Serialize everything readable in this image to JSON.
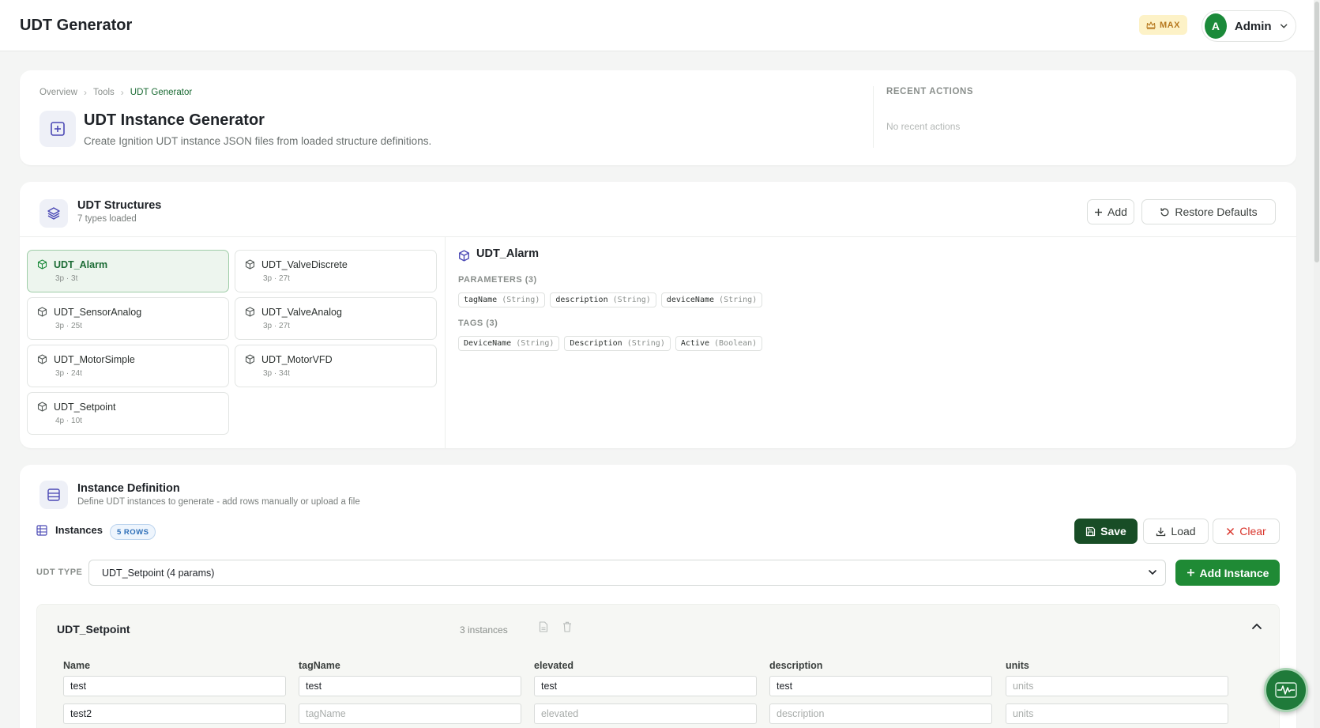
{
  "app": {
    "title": "UDT Generator",
    "plan_badge": "MAX",
    "user_initial": "A",
    "user_name": "Admin"
  },
  "colors": {
    "accent_green": "#1f8a35",
    "dark_green": "#184d26",
    "danger": "#d9342b",
    "badge_blue": "#2e6fb8"
  },
  "header_card": {
    "breadcrumb": [
      "Overview",
      "Tools",
      "UDT Generator"
    ],
    "title": "UDT Instance Generator",
    "subtitle": "Create Ignition UDT instance JSON files from loaded structure definitions.",
    "recent_label": "RECENT ACTIONS",
    "recent_empty": "No recent actions",
    "icon": "plus-square-icon"
  },
  "structures": {
    "title": "UDT Structures",
    "subtitle": "7 types loaded",
    "add_label": "Add",
    "restore_label": "Restore Defaults",
    "items": [
      {
        "name": "UDT_Alarm",
        "meta": "3p · 3t",
        "active": true
      },
      {
        "name": "UDT_ValveDiscrete",
        "meta": "3p · 27t",
        "active": false
      },
      {
        "name": "UDT_SensorAnalog",
        "meta": "3p · 25t",
        "active": false
      },
      {
        "name": "UDT_ValveAnalog",
        "meta": "3p · 27t",
        "active": false
      },
      {
        "name": "UDT_MotorSimple",
        "meta": "3p · 24t",
        "active": false
      },
      {
        "name": "UDT_MotorVFD",
        "meta": "3p · 34t",
        "active": false
      },
      {
        "name": "UDT_Setpoint",
        "meta": "4p · 10t",
        "active": false
      }
    ],
    "detail": {
      "title": "UDT_Alarm",
      "params_label": "PARAMETERS (3)",
      "params": [
        {
          "name": "tagName",
          "type": "(String)"
        },
        {
          "name": "description",
          "type": "(String)"
        },
        {
          "name": "deviceName",
          "type": "(String)"
        }
      ],
      "tags_label": "TAGS (3)",
      "tags": [
        {
          "name": "DeviceName",
          "type": "(String)"
        },
        {
          "name": "Description",
          "type": "(String)"
        },
        {
          "name": "Active",
          "type": "(Boolean)"
        }
      ]
    }
  },
  "instances": {
    "title": "Instance Definition",
    "subtitle": "Define UDT instances to generate - add rows manually or upload a file",
    "instances_label": "Instances",
    "rows_badge": "5 ROWS",
    "save_label": "Save",
    "load_label": "Load",
    "clear_label": "Clear",
    "udt_type_label": "UDT TYPE",
    "udt_type_value": "UDT_Setpoint (4 params)",
    "add_instance_label": "Add Instance",
    "group": {
      "title": "UDT_Setpoint",
      "count": "3 instances",
      "columns": [
        "Name",
        "tagName",
        "elevated",
        "description",
        "units"
      ],
      "rows": [
        [
          {
            "value": "test",
            "placeholder": ""
          },
          {
            "value": "test",
            "placeholder": ""
          },
          {
            "value": "test",
            "placeholder": ""
          },
          {
            "value": "test",
            "placeholder": ""
          },
          {
            "value": "",
            "placeholder": "units"
          }
        ],
        [
          {
            "value": "test2",
            "placeholder": ""
          },
          {
            "value": "",
            "placeholder": "tagName"
          },
          {
            "value": "",
            "placeholder": "elevated"
          },
          {
            "value": "",
            "placeholder": "description"
          },
          {
            "value": "",
            "placeholder": "units"
          }
        ]
      ]
    }
  }
}
